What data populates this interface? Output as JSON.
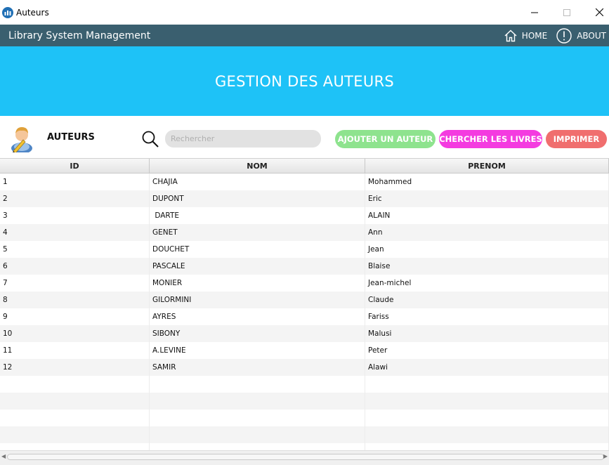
{
  "window": {
    "title": "Auteurs"
  },
  "navbar": {
    "title": "Library System Management",
    "home_label": "HOME",
    "about_label": "ABOUT"
  },
  "banner": {
    "title": "GESTION DES AUTEURS"
  },
  "toolbar": {
    "section_label": "AUTEURS",
    "search_placeholder": "Rechercher",
    "add_label": "AJOUTER UN AUTEUR",
    "books_label": "CHERCHER LES LIVRES",
    "print_label": "IMPRIMER"
  },
  "colors": {
    "navbar": "#3a5f6f",
    "banner": "#1ec2f7",
    "add_btn": "#8ee38e",
    "books_btn": "#f43be0",
    "print_btn": "#f06e6e"
  },
  "table": {
    "headers": [
      "ID",
      "NOM",
      "PRENOM"
    ],
    "rows": [
      [
        "1",
        "CHAJIA",
        "Mohammed"
      ],
      [
        "2",
        "DUPONT",
        "Eric"
      ],
      [
        "3",
        " DARTE",
        "ALAIN"
      ],
      [
        "4",
        "GENET",
        "Ann"
      ],
      [
        "5",
        "DOUCHET",
        "Jean"
      ],
      [
        "6",
        "PASCALE",
        "Blaise"
      ],
      [
        "7",
        "MONIER",
        "Jean-michel"
      ],
      [
        "8",
        "GILORMINI",
        "Claude"
      ],
      [
        "9",
        "AYRES",
        "Fariss"
      ],
      [
        "10",
        "SIBONY",
        "Malusi"
      ],
      [
        "11",
        "A.LEVINE",
        "Peter"
      ],
      [
        "12",
        "SAMIR",
        "Alawi"
      ]
    ],
    "empty_rows": 5
  }
}
